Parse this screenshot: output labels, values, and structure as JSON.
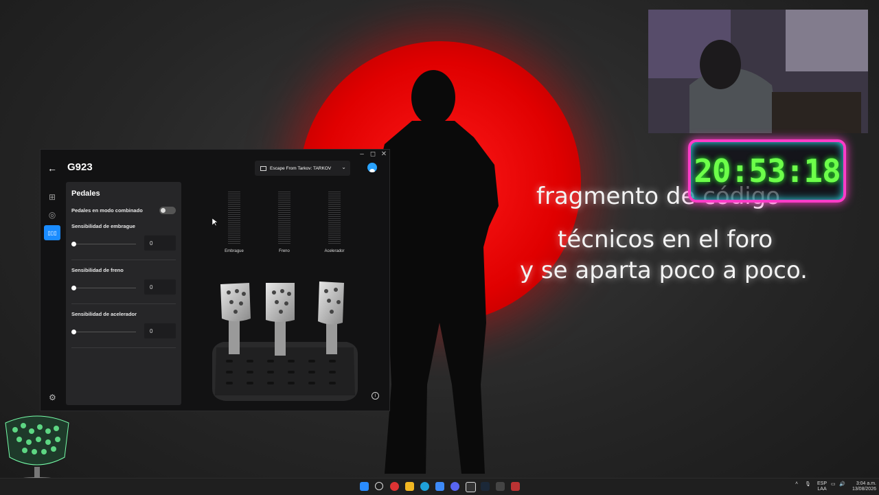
{
  "app": {
    "title": "G923",
    "back_icon": "arrow-left-icon",
    "game_profile": "Escape From Tarkov: TARKOV",
    "window_controls": {
      "minimize": "–",
      "maximize": "◻",
      "close": "✕"
    }
  },
  "sidebar": {
    "items": [
      {
        "name": "add-icon",
        "glyph": "⊞"
      },
      {
        "name": "steering-wheel-icon",
        "glyph": "◎"
      },
      {
        "name": "pedals-icon",
        "glyph": "▯▯▯",
        "active": true
      }
    ],
    "settings_glyph": "⚙"
  },
  "pedals_panel": {
    "title": "Pedales",
    "combined_mode_label": "Pedales en modo combinado",
    "combined_mode_on": false,
    "sliders": [
      {
        "label": "Sensibilidad de embrague",
        "value": "0"
      },
      {
        "label": "Sensibilidad de freno",
        "value": "0"
      },
      {
        "label": "Sensibilidad de acelerador",
        "value": "0"
      }
    ]
  },
  "meters": [
    {
      "label": "Embrague",
      "level": 0
    },
    {
      "label": "Freno",
      "level": 0
    },
    {
      "label": "Acelerador",
      "level": 0
    }
  ],
  "info_glyph": "i",
  "overlay": {
    "lines": [
      "fragmento de código",
      "técnicos en el foro",
      "y se aparta poco a poco."
    ],
    "clock": "20:53:18"
  },
  "taskbar": {
    "lang_top": "ESP",
    "lang_bottom": "LAA",
    "time": "3:04 a.m.",
    "date": "13/08/2026"
  },
  "colors": {
    "accent": "#1a8cff",
    "red": "#e00000",
    "clock_green": "#6dff4a",
    "clock_border": "#ff3cc8"
  }
}
